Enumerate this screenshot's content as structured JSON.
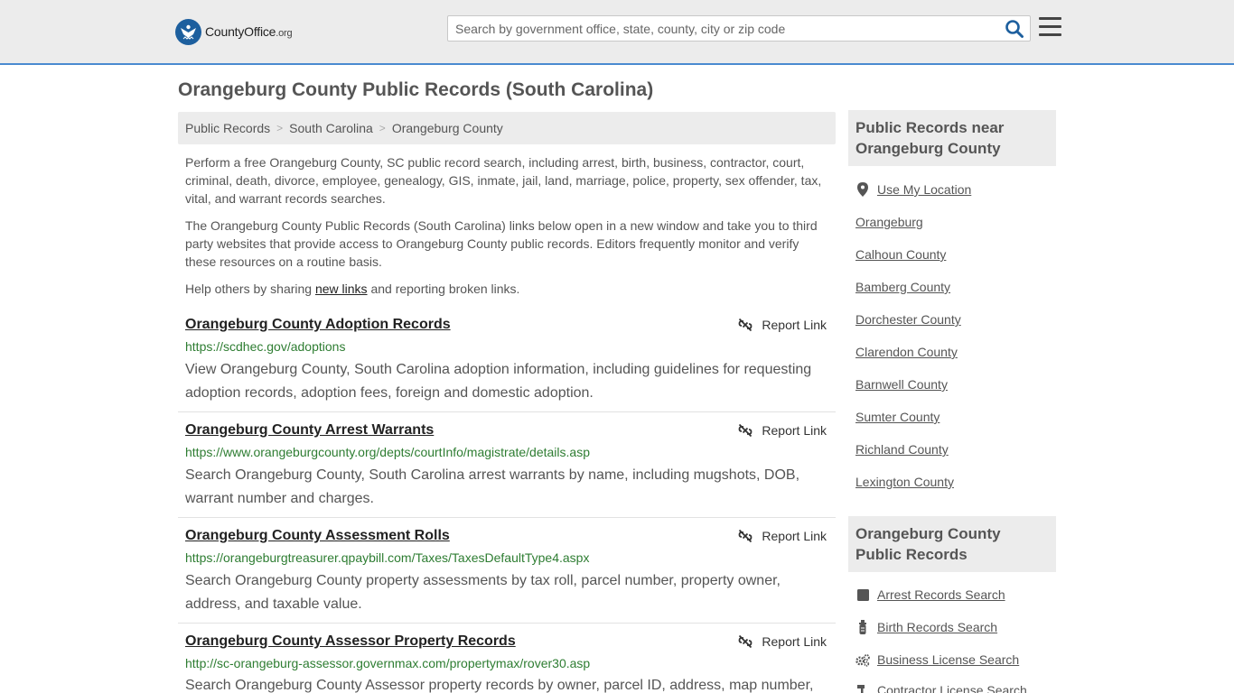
{
  "header": {
    "logo_main": "CountyOffice",
    "logo_suffix": ".org",
    "search_placeholder": "Search by government office, state, county, city or zip code"
  },
  "page": {
    "title": "Orangeburg County Public Records (South Carolina)",
    "breadcrumb": [
      "Public Records",
      "South Carolina",
      "Orangeburg County"
    ],
    "intro1": "Perform a free Orangeburg County, SC public record search, including arrest, birth, business, contractor, court, criminal, death, divorce, employee, genealogy, GIS, inmate, jail, land, marriage, police, property, sex offender, tax, vital, and warrant records searches.",
    "intro2": "The Orangeburg County Public Records (South Carolina) links below open in a new window and take you to third party websites that provide access to Orangeburg County public records. Editors frequently monitor and verify these resources on a routine basis.",
    "help_prefix": "Help others by sharing ",
    "help_link": "new links",
    "help_suffix": " and reporting broken links.",
    "report_label": "Report Link"
  },
  "records": [
    {
      "title": "Orangeburg County Adoption Records",
      "url": "https://scdhec.gov/adoptions",
      "desc": "View Orangeburg County, South Carolina adoption information, including guidelines for requesting adoption records, adoption fees, foreign and domestic adoption."
    },
    {
      "title": "Orangeburg County Arrest Warrants",
      "url": "https://www.orangeburgcounty.org/depts/courtInfo/magistrate/details.asp",
      "desc": "Search Orangeburg County, South Carolina arrest warrants by name, including mugshots, DOB, warrant number and charges."
    },
    {
      "title": "Orangeburg County Assessment Rolls",
      "url": "https://orangeburgtreasurer.qpaybill.com/Taxes/TaxesDefaultType4.aspx",
      "desc": "Search Orangeburg County property assessments by tax roll, parcel number, property owner, address, and taxable value."
    },
    {
      "title": "Orangeburg County Assessor Property Records",
      "url": "http://sc-orangeburg-assessor.governmax.com/propertymax/rover30.asp",
      "desc": "Search Orangeburg County Assessor property records by owner, parcel ID, address, map number,"
    }
  ],
  "sidebar": {
    "near_heading": "Public Records near Orangeburg County",
    "use_location": "Use My Location",
    "near_links": [
      "Orangeburg",
      "Calhoun County",
      "Bamberg County",
      "Dorchester County",
      "Clarendon County",
      "Barnwell County",
      "Sumter County",
      "Richland County",
      "Lexington County"
    ],
    "records_heading": "Orangeburg County Public Records",
    "record_links": [
      "Arrest Records Search",
      "Birth Records Search",
      "Business License Search",
      "Contractor License Search"
    ]
  }
}
